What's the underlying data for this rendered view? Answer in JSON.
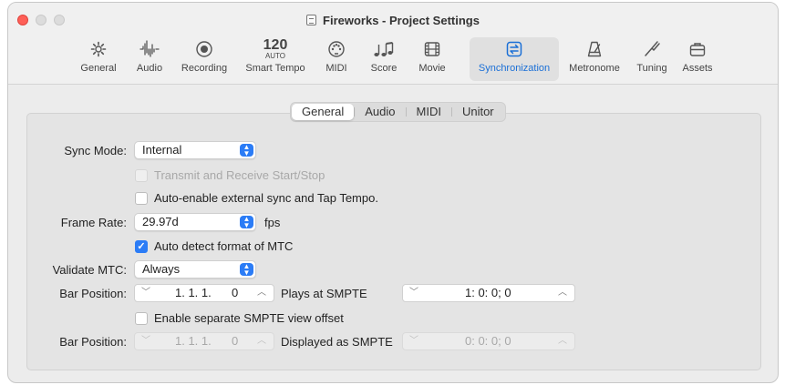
{
  "window": {
    "title": "Fireworks - Project Settings"
  },
  "toolbar": {
    "items": [
      {
        "label": "General",
        "icon": "gear-icon"
      },
      {
        "label": "Audio",
        "icon": "waveform-icon"
      },
      {
        "label": "Recording",
        "icon": "record-icon"
      },
      {
        "label": "Smart Tempo",
        "icon": "tempo-icon",
        "tempo_value": "120",
        "tempo_mode": "AUTO"
      },
      {
        "label": "MIDI",
        "icon": "midi-icon"
      },
      {
        "label": "Score",
        "icon": "music-notes-icon"
      },
      {
        "label": "Movie",
        "icon": "film-icon"
      },
      {
        "label": "Synchronization",
        "icon": "sync-icon",
        "active": true
      },
      {
        "label": "Metronome",
        "icon": "metronome-icon"
      },
      {
        "label": "Tuning",
        "icon": "tuning-fork-icon"
      },
      {
        "label": "Assets",
        "icon": "briefcase-icon"
      }
    ]
  },
  "tabs": [
    "General",
    "Audio",
    "MIDI",
    "Unitor"
  ],
  "active_tab": "General",
  "form": {
    "sync_mode": {
      "label": "Sync Mode:",
      "value": "Internal"
    },
    "transmit_receive": {
      "label": "Transmit and Receive Start/Stop",
      "checked": false,
      "disabled": true
    },
    "auto_enable": {
      "label": "Auto-enable external sync and Tap Tempo.",
      "checked": false
    },
    "frame_rate": {
      "label": "Frame Rate:",
      "value": "29.97d",
      "unit": "fps"
    },
    "auto_detect": {
      "label": "Auto detect format of MTC",
      "checked": true
    },
    "validate_mtc": {
      "label": "Validate MTC:",
      "value": "Always"
    },
    "bar_position_1": {
      "label": "Bar Position:",
      "bar_value": "1. 1. 1.",
      "bar_ticks": "0",
      "plays_label": "Plays at SMPTE",
      "smpte_value": "1: 0: 0; 0"
    },
    "separate_offset": {
      "label": "Enable separate SMPTE view offset",
      "checked": false
    },
    "bar_position_2": {
      "label": "Bar Position:",
      "bar_value": "1. 1. 1.",
      "bar_ticks": "0",
      "displayed_label": "Displayed as SMPTE",
      "smpte_value": "0: 0: 0; 0",
      "disabled": true
    }
  },
  "colors": {
    "accent": "#2b7cf6",
    "active_tab_text": "#1a6fd6",
    "close_button": "#fe5f57"
  }
}
